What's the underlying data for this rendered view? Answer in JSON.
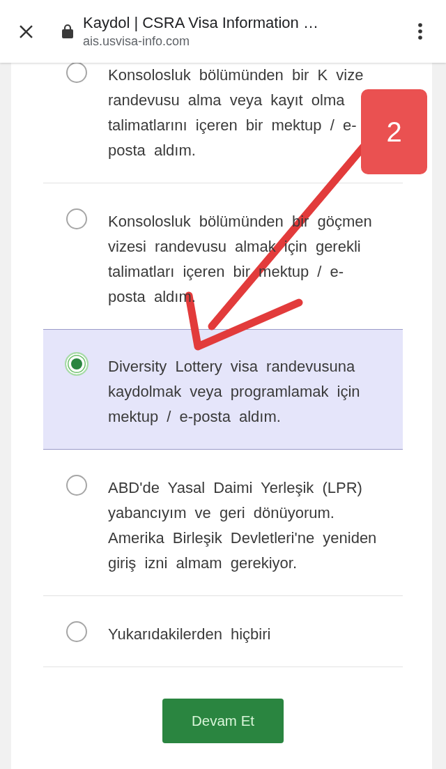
{
  "browser": {
    "title": "Kaydol | CSRA Visa Information …",
    "url": "ais.usvisa-info.com"
  },
  "options": [
    {
      "label": "Konsolosluk bölümünden bir K vize randevusu alma veya kayıt olma talimatlarını içeren bir mektup / e-posta aldım.",
      "selected": false
    },
    {
      "label": "Konsolosluk bölümünden bir göçmen vizesi randevusu almak için gerekli talimatları içeren bir mektup / e-posta aldım.",
      "selected": false
    },
    {
      "label": "Diversity Lottery visa randevusuna kaydolmak veya programlamak için mektup / e-posta aldım.",
      "selected": true
    },
    {
      "label": "ABD'de Yasal Daimi Yerleşik (LPR) yabancıyım ve geri dönüyorum. Amerika Birleşik Devletleri'ne yeniden giriş izni almam gerekiyor.",
      "selected": false
    },
    {
      "label": "Yukarıdakilerden hiçbiri",
      "selected": false
    }
  ],
  "continue_button": {
    "label": "Devam Et"
  },
  "annotation": {
    "label": "2"
  }
}
